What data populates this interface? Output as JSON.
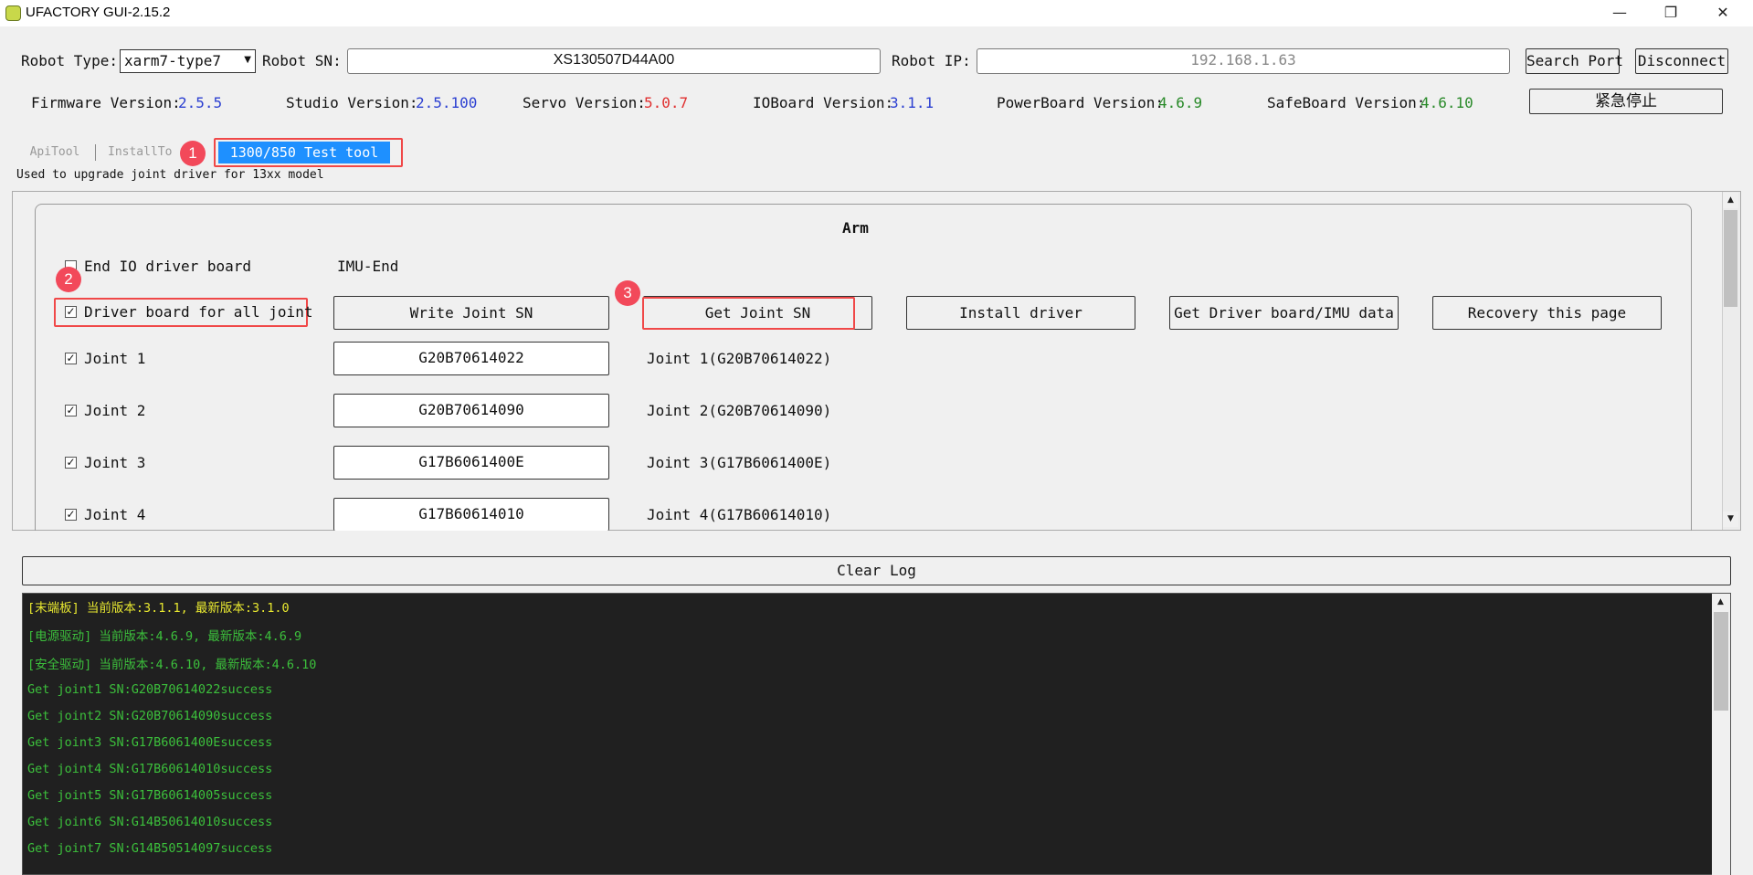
{
  "window": {
    "title": "UFACTORY GUI-2.15.2",
    "minimize": "—",
    "restore": "❐",
    "close": "✕"
  },
  "robot": {
    "type_label": "Robot Type:",
    "type_value": "xarm7-type7",
    "sn_label": "Robot SN:",
    "sn_value": "XS130507D44A00",
    "ip_label": "Robot IP:",
    "ip_value": "192.168.1.63",
    "search_port": "Search Port",
    "disconnect": "Disconnect"
  },
  "versions": [
    {
      "label": "Firmware Version:",
      "value": "2.5.5",
      "color": "#2b3fd1"
    },
    {
      "label": "Studio Version:",
      "value": "2.5.100",
      "color": "#2b3fd1"
    },
    {
      "label": "Servo Version:",
      "value": "5.0.7",
      "color": "#e03030"
    },
    {
      "label": "IOBoard Version:",
      "value": "3.1.1",
      "color": "#2b3fd1"
    },
    {
      "label": "PowerBoard Version:",
      "value": "4.6.9",
      "color": "#2a8a2a"
    },
    {
      "label": "SafeBoard Version:",
      "value": "4.6.10",
      "color": "#2a8a2a"
    }
  ],
  "estop": "紧急停止",
  "tabs": [
    {
      "label": "ApiTool"
    },
    {
      "label": "InstallTo"
    },
    {
      "label": "1300/850 Test tool"
    }
  ],
  "tab_description": "Used to upgrade joint driver for 13xx model",
  "arm": {
    "title": "Arm",
    "end_io_label": "End IO driver board",
    "imu_label": "IMU-End",
    "driver_all_label": "Driver board for all joint",
    "buttons": {
      "write_sn": "Write Joint SN",
      "get_sn": "Get Joint SN",
      "install": "Install driver",
      "get_data": "Get Driver board/IMU data",
      "recovery": "Recovery this page"
    },
    "joints": [
      {
        "label": "Joint 1",
        "sn": "G20B70614022",
        "result": "Joint 1(G20B70614022)"
      },
      {
        "label": "Joint 2",
        "sn": "G20B70614090",
        "result": "Joint 2(G20B70614090)"
      },
      {
        "label": "Joint 3",
        "sn": "G17B6061400E",
        "result": "Joint 3(G17B6061400E)"
      },
      {
        "label": "Joint 4",
        "sn": "G17B60614010",
        "result": "Joint 4(G17B60614010)"
      }
    ]
  },
  "badges": [
    "1",
    "2",
    "3"
  ],
  "clear_log": "Clear Log",
  "log": [
    {
      "text": "[末端板] 当前版本:3.1.1, 最新版本:3.1.0",
      "color": "#e8e830"
    },
    {
      "text": "[电源驱动] 当前版本:4.6.9, 最新版本:4.6.9",
      "color": "#3cc03c"
    },
    {
      "text": "[安全驱动] 当前版本:4.6.10, 最新版本:4.6.10",
      "color": "#3cc03c"
    },
    {
      "text": "Get joint1 SN:G20B70614022success",
      "color": "#3cc03c"
    },
    {
      "text": "Get joint2 SN:G20B70614090success",
      "color": "#3cc03c"
    },
    {
      "text": "Get joint3 SN:G17B6061400Esuccess",
      "color": "#3cc03c"
    },
    {
      "text": "Get joint4 SN:G17B60614010success",
      "color": "#3cc03c"
    },
    {
      "text": "Get joint5 SN:G17B60614005success",
      "color": "#3cc03c"
    },
    {
      "text": "Get joint6 SN:G14B50614010success",
      "color": "#3cc03c"
    },
    {
      "text": "Get joint7 SN:G14B50514097success",
      "color": "#3cc03c"
    }
  ]
}
